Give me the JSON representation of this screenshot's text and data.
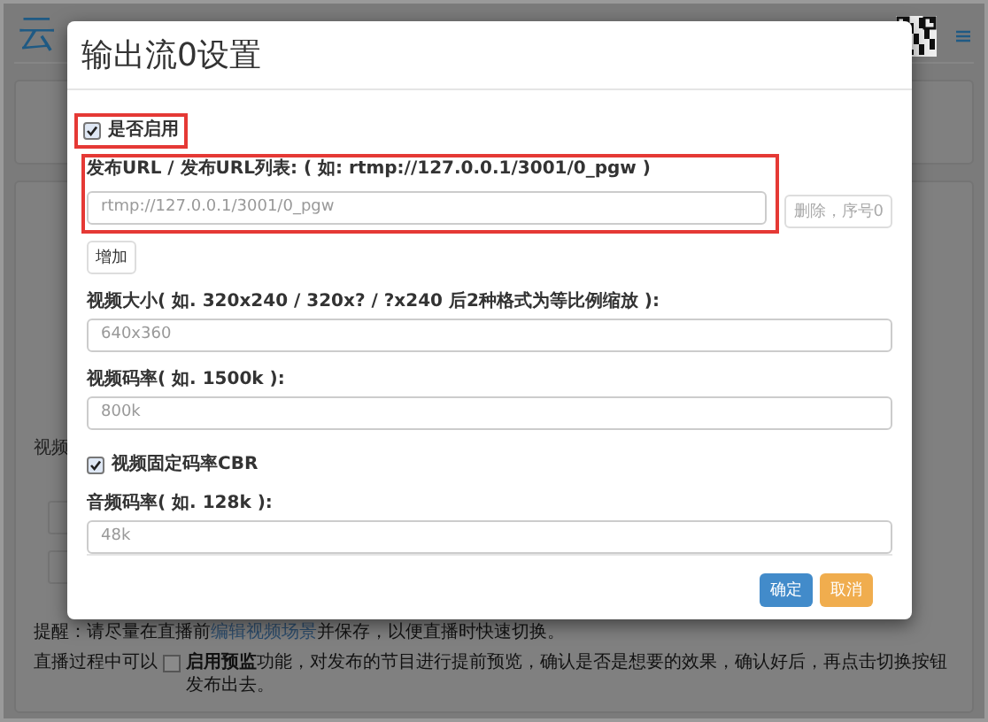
{
  "background": {
    "title": "云",
    "section_label": "视频",
    "hint_1": {
      "before": "提醒：请尽量在直播前",
      "link": "编辑视频场景",
      "after": "并保存，以便直播时快速切换。"
    },
    "hint_2": {
      "before": "直播过程中可以",
      "checked": false,
      "after": "**启用预监**功能，对发布的节目进行提前预览，确认是否是想要的效果，确认好后，再点击切换按钮发布出去。"
    }
  },
  "dialog": {
    "title": "输出流0设置",
    "enabled": {
      "label": "是否启用",
      "checked": true
    },
    "url": {
      "label": "发布URL / 发布URL列表: ( 如: rtmp://127.0.0.1/3001/0_pgw )",
      "rows": [
        {
          "placeholder": "rtmp://127.0.0.1/3001/0_pgw",
          "delete_label": "删除，序号0",
          "disabled": true
        }
      ],
      "add_label": "增加"
    },
    "fields": [
      {
        "kind": "input",
        "label": "视频大小( 如. 320x240 / 320x? / ?x240 后2种格式为等比例缩放 ):",
        "placeholder": "640x360"
      },
      {
        "kind": "input",
        "label": "视频码率( 如. 1500k ):",
        "placeholder": "800k"
      },
      {
        "kind": "checkbox",
        "label": "视频固定码率CBR",
        "checked": true
      },
      {
        "kind": "input",
        "label": "音频码率( 如. 128k ):",
        "placeholder": "48k"
      }
    ],
    "buttons": [
      {
        "label": "确定",
        "kind": "primary"
      },
      {
        "label": "取消",
        "kind": "warning"
      }
    ]
  }
}
